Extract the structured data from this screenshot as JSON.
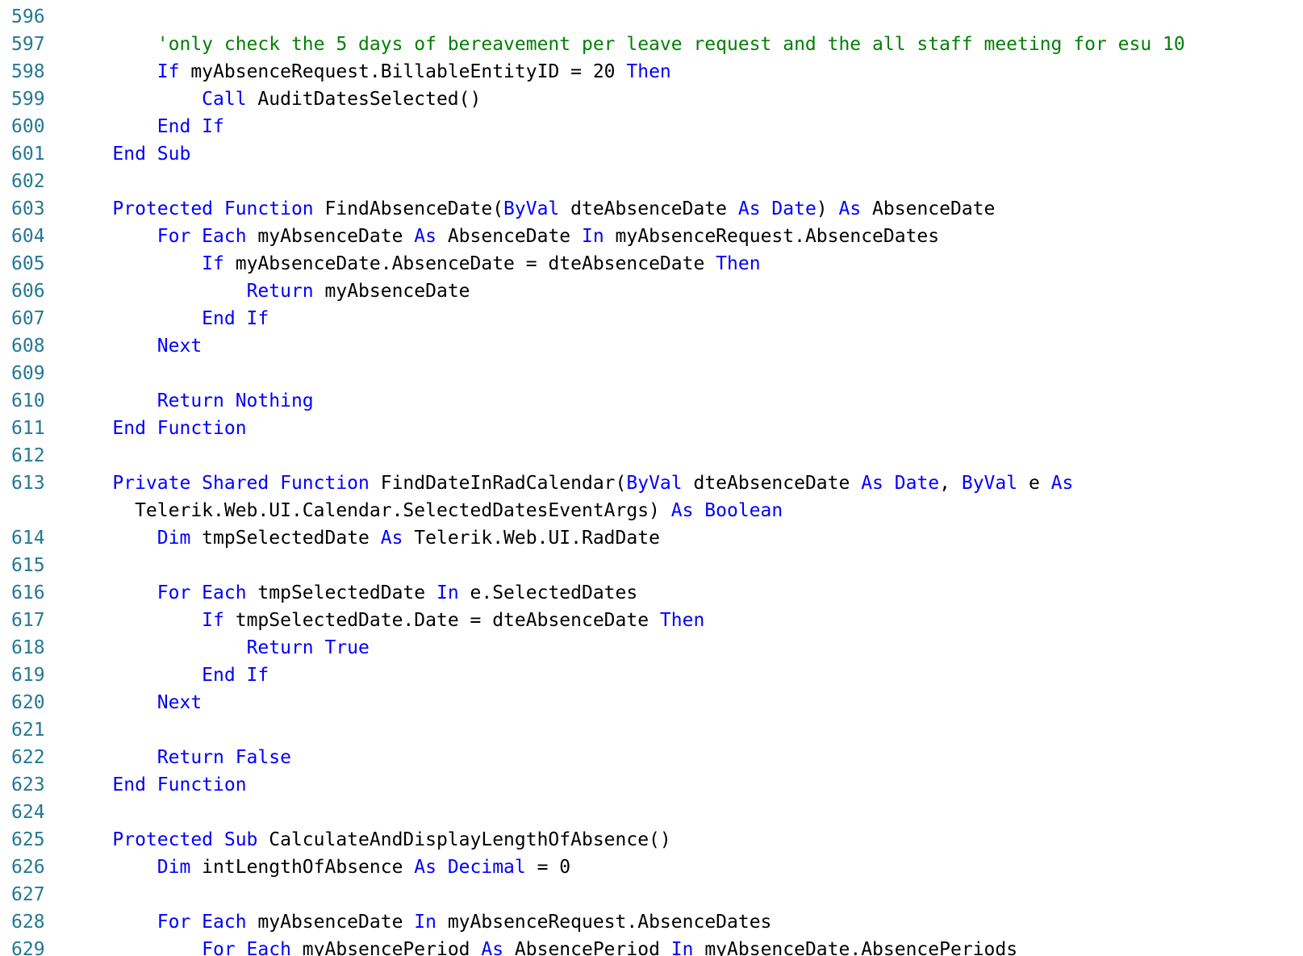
{
  "editor": {
    "colors": {
      "keyword": "#0000ff",
      "comment": "#008000",
      "text": "#000000",
      "line_number": "#237893",
      "background": "#ffffff"
    },
    "lines": [
      {
        "num": "596",
        "tokens": []
      },
      {
        "num": "597",
        "tokens": [
          {
            "t": "        ",
            "k": "tx"
          },
          {
            "t": "'only check the 5 days of bereavement per leave request and the all staff meeting for esu 10",
            "k": "cm"
          }
        ]
      },
      {
        "num": "598",
        "tokens": [
          {
            "t": "        ",
            "k": "tx"
          },
          {
            "t": "If",
            "k": "kw"
          },
          {
            "t": " myAbsenceRequest.BillableEntityID = 20 ",
            "k": "tx"
          },
          {
            "t": "Then",
            "k": "kw"
          }
        ]
      },
      {
        "num": "599",
        "tokens": [
          {
            "t": "            ",
            "k": "tx"
          },
          {
            "t": "Call",
            "k": "kw"
          },
          {
            "t": " AuditDatesSelected()",
            "k": "tx"
          }
        ]
      },
      {
        "num": "600",
        "tokens": [
          {
            "t": "        ",
            "k": "tx"
          },
          {
            "t": "End If",
            "k": "kw"
          }
        ]
      },
      {
        "num": "601",
        "tokens": [
          {
            "t": "    ",
            "k": "tx"
          },
          {
            "t": "End Sub",
            "k": "kw"
          }
        ]
      },
      {
        "num": "602",
        "tokens": []
      },
      {
        "num": "603",
        "tokens": [
          {
            "t": "    ",
            "k": "tx"
          },
          {
            "t": "Protected Function",
            "k": "kw"
          },
          {
            "t": " FindAbsenceDate(",
            "k": "tx"
          },
          {
            "t": "ByVal",
            "k": "kw"
          },
          {
            "t": " dteAbsenceDate ",
            "k": "tx"
          },
          {
            "t": "As Date",
            "k": "kw"
          },
          {
            "t": ") ",
            "k": "tx"
          },
          {
            "t": "As",
            "k": "kw"
          },
          {
            "t": " AbsenceDate",
            "k": "tx"
          }
        ]
      },
      {
        "num": "604",
        "tokens": [
          {
            "t": "        ",
            "k": "tx"
          },
          {
            "t": "For Each",
            "k": "kw"
          },
          {
            "t": " myAbsenceDate ",
            "k": "tx"
          },
          {
            "t": "As",
            "k": "kw"
          },
          {
            "t": " AbsenceDate ",
            "k": "tx"
          },
          {
            "t": "In",
            "k": "kw"
          },
          {
            "t": " myAbsenceRequest.AbsenceDates",
            "k": "tx"
          }
        ]
      },
      {
        "num": "605",
        "tokens": [
          {
            "t": "            ",
            "k": "tx"
          },
          {
            "t": "If",
            "k": "kw"
          },
          {
            "t": " myAbsenceDate.AbsenceDate = dteAbsenceDate ",
            "k": "tx"
          },
          {
            "t": "Then",
            "k": "kw"
          }
        ]
      },
      {
        "num": "606",
        "tokens": [
          {
            "t": "                ",
            "k": "tx"
          },
          {
            "t": "Return",
            "k": "kw"
          },
          {
            "t": " myAbsenceDate",
            "k": "tx"
          }
        ]
      },
      {
        "num": "607",
        "tokens": [
          {
            "t": "            ",
            "k": "tx"
          },
          {
            "t": "End If",
            "k": "kw"
          }
        ]
      },
      {
        "num": "608",
        "tokens": [
          {
            "t": "        ",
            "k": "tx"
          },
          {
            "t": "Next",
            "k": "kw"
          }
        ]
      },
      {
        "num": "609",
        "tokens": []
      },
      {
        "num": "610",
        "tokens": [
          {
            "t": "        ",
            "k": "tx"
          },
          {
            "t": "Return Nothing",
            "k": "kw"
          }
        ]
      },
      {
        "num": "611",
        "tokens": [
          {
            "t": "    ",
            "k": "tx"
          },
          {
            "t": "End Function",
            "k": "kw"
          }
        ]
      },
      {
        "num": "612",
        "tokens": []
      },
      {
        "num": "613",
        "wrap": true,
        "tokens": [
          {
            "t": "    ",
            "k": "tx"
          },
          {
            "t": "Private Shared Function",
            "k": "kw"
          },
          {
            "t": " FindDateInRadCalendar(",
            "k": "tx"
          },
          {
            "t": "ByVal",
            "k": "kw"
          },
          {
            "t": " dteAbsenceDate ",
            "k": "tx"
          },
          {
            "t": "As Date",
            "k": "kw"
          },
          {
            "t": ", ",
            "k": "tx"
          },
          {
            "t": "ByVal",
            "k": "kw"
          },
          {
            "t": " e ",
            "k": "tx"
          },
          {
            "t": "As",
            "k": "kw"
          }
        ],
        "cont": [
          {
            "t": "      Telerik.Web.UI.Calendar.SelectedDatesEventArgs) ",
            "k": "tx"
          },
          {
            "t": "As Boolean",
            "k": "kw"
          }
        ]
      },
      {
        "num": "614",
        "tokens": [
          {
            "t": "        ",
            "k": "tx"
          },
          {
            "t": "Dim",
            "k": "kw"
          },
          {
            "t": " tmpSelectedDate ",
            "k": "tx"
          },
          {
            "t": "As",
            "k": "kw"
          },
          {
            "t": " Telerik.Web.UI.RadDate",
            "k": "tx"
          }
        ]
      },
      {
        "num": "615",
        "tokens": []
      },
      {
        "num": "616",
        "tokens": [
          {
            "t": "        ",
            "k": "tx"
          },
          {
            "t": "For Each",
            "k": "kw"
          },
          {
            "t": " tmpSelectedDate ",
            "k": "tx"
          },
          {
            "t": "In",
            "k": "kw"
          },
          {
            "t": " e.SelectedDates",
            "k": "tx"
          }
        ]
      },
      {
        "num": "617",
        "tokens": [
          {
            "t": "            ",
            "k": "tx"
          },
          {
            "t": "If",
            "k": "kw"
          },
          {
            "t": " tmpSelectedDate.Date = dteAbsenceDate ",
            "k": "tx"
          },
          {
            "t": "Then",
            "k": "kw"
          }
        ]
      },
      {
        "num": "618",
        "tokens": [
          {
            "t": "                ",
            "k": "tx"
          },
          {
            "t": "Return True",
            "k": "kw"
          }
        ]
      },
      {
        "num": "619",
        "tokens": [
          {
            "t": "            ",
            "k": "tx"
          },
          {
            "t": "End If",
            "k": "kw"
          }
        ]
      },
      {
        "num": "620",
        "tokens": [
          {
            "t": "        ",
            "k": "tx"
          },
          {
            "t": "Next",
            "k": "kw"
          }
        ]
      },
      {
        "num": "621",
        "tokens": []
      },
      {
        "num": "622",
        "tokens": [
          {
            "t": "        ",
            "k": "tx"
          },
          {
            "t": "Return False",
            "k": "kw"
          }
        ]
      },
      {
        "num": "623",
        "tokens": [
          {
            "t": "    ",
            "k": "tx"
          },
          {
            "t": "End Function",
            "k": "kw"
          }
        ]
      },
      {
        "num": "624",
        "tokens": []
      },
      {
        "num": "625",
        "tokens": [
          {
            "t": "    ",
            "k": "tx"
          },
          {
            "t": "Protected Sub",
            "k": "kw"
          },
          {
            "t": " CalculateAndDisplayLengthOfAbsence()",
            "k": "tx"
          }
        ]
      },
      {
        "num": "626",
        "tokens": [
          {
            "t": "        ",
            "k": "tx"
          },
          {
            "t": "Dim",
            "k": "kw"
          },
          {
            "t": " intLengthOfAbsence ",
            "k": "tx"
          },
          {
            "t": "As Decimal",
            "k": "kw"
          },
          {
            "t": " = 0",
            "k": "tx"
          }
        ]
      },
      {
        "num": "627",
        "tokens": []
      },
      {
        "num": "628",
        "tokens": [
          {
            "t": "        ",
            "k": "tx"
          },
          {
            "t": "For Each",
            "k": "kw"
          },
          {
            "t": " myAbsenceDate ",
            "k": "tx"
          },
          {
            "t": "In",
            "k": "kw"
          },
          {
            "t": " myAbsenceRequest.AbsenceDates",
            "k": "tx"
          }
        ]
      },
      {
        "num": "629",
        "tokens": [
          {
            "t": "            ",
            "k": "tx"
          },
          {
            "t": "For Each",
            "k": "kw"
          },
          {
            "t": " myAbsencePeriod ",
            "k": "tx"
          },
          {
            "t": "As",
            "k": "kw"
          },
          {
            "t": " AbsencePeriod ",
            "k": "tx"
          },
          {
            "t": "In",
            "k": "kw"
          },
          {
            "t": " myAbsenceDate.AbsencePeriods",
            "k": "tx"
          }
        ]
      }
    ]
  }
}
